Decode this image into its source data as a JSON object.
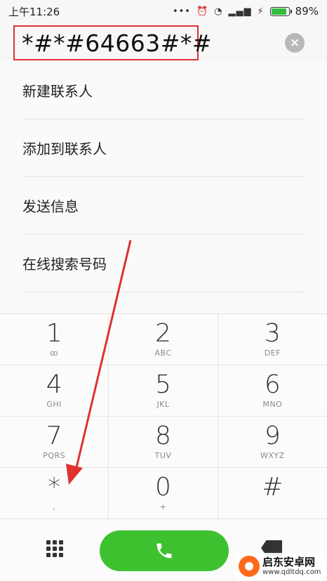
{
  "status_bar": {
    "time": "上午11:26",
    "icons": [
      "dots-icon",
      "alarm-icon",
      "wifi-icon",
      "signal-icon",
      "charging-icon"
    ],
    "battery_percent": "89%",
    "battery_level": 0.89
  },
  "dialer": {
    "number": "*#*#64663#*#",
    "clear_icon": "×"
  },
  "menu": {
    "items": [
      {
        "label": "新建联系人"
      },
      {
        "label": "添加到联系人"
      },
      {
        "label": "发送信息"
      },
      {
        "label": "在线搜索号码"
      }
    ]
  },
  "keypad": {
    "keys": [
      {
        "digit": "1",
        "letters": "ꝏ"
      },
      {
        "digit": "2",
        "letters": "ABC"
      },
      {
        "digit": "3",
        "letters": "DEF"
      },
      {
        "digit": "4",
        "letters": "GHI"
      },
      {
        "digit": "5",
        "letters": "JKL"
      },
      {
        "digit": "6",
        "letters": "MNO"
      },
      {
        "digit": "7",
        "letters": "PQRS"
      },
      {
        "digit": "8",
        "letters": "TUV"
      },
      {
        "digit": "9",
        "letters": "WXYZ"
      },
      {
        "digit": "*",
        "letters": ","
      },
      {
        "digit": "0",
        "letters": "+"
      },
      {
        "digit": "#",
        "letters": ""
      }
    ]
  },
  "bottom": {
    "call_color": "#3ec12f"
  },
  "watermark": {
    "title": "启东安卓网",
    "url": "www.qdltdq.com"
  },
  "colors": {
    "highlight_box": "#e03131",
    "arrow": "#e03131"
  }
}
